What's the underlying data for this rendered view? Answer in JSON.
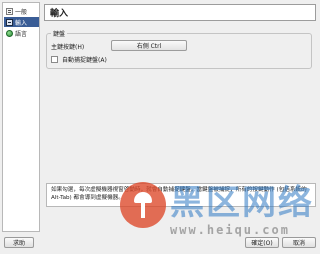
{
  "sidebar": {
    "items": [
      {
        "label": "一般",
        "icon": "general-icon",
        "selected": false
      },
      {
        "label": "輸入",
        "icon": "keyboard-icon",
        "selected": true
      },
      {
        "label": "語言",
        "icon": "globe-icon",
        "selected": false
      }
    ]
  },
  "page": {
    "title": "輸入"
  },
  "keyboard_group": {
    "title": "鍵盤",
    "shortcut_label": "主鍵按鍵(H)",
    "shortcut_value": "右側 Ctrl",
    "auto_capture_label": "自動捕捉鍵盤(A)",
    "auto_capture_checked": false
  },
  "description": {
    "text": "如果勾選，每次虛擬機器視窗啓動時，就會自動捕捉鍵盤。當鍵盤被捕捉，所有的按鍵動作 (包括系統的 Alt-Tab) 都會導到虛擬機器。"
  },
  "buttons": {
    "help": "求助",
    "ok": "確定(O)",
    "cancel": "取消"
  },
  "watermark": {
    "text": "黑区网络",
    "url": "www.heiqu.com"
  },
  "colors": {
    "selection": "#3a5d96",
    "watermark_blue": "#2d78c3",
    "watermark_logo": "#dc4628"
  }
}
